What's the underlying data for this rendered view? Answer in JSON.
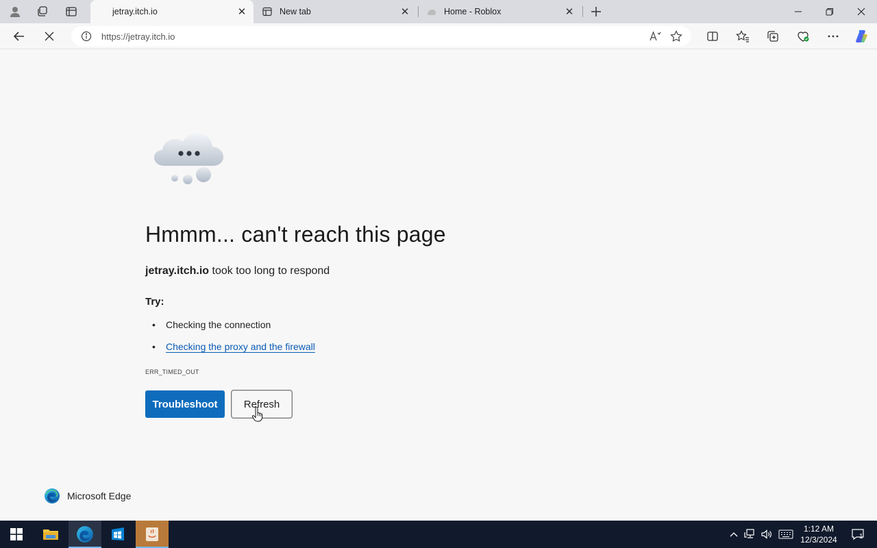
{
  "tabs": [
    {
      "title": "jetray.itch.io",
      "active": true
    },
    {
      "title": "New tab",
      "active": false
    },
    {
      "title": "Home - Roblox",
      "active": false
    }
  ],
  "toolbar": {
    "url": "https://jetray.itch.io"
  },
  "error_page": {
    "heading": "Hmmm... can't reach this page",
    "site": "jetray.itch.io",
    "message": " took too long to respond",
    "try_label": "Try:",
    "suggestions": [
      "Checking the connection",
      "Checking the proxy and the firewall"
    ],
    "error_code": "ERR_TIMED_OUT",
    "troubleshoot_label": "Troubleshoot",
    "refresh_label": "Refresh",
    "brand": "Microsoft Edge"
  },
  "taskbar": {
    "time": "1:12 AM",
    "date": "12/3/2024",
    "notification_count": "1"
  },
  "colors": {
    "accent": "#0f6cbd",
    "link": "#0a5bb5",
    "taskbar": "#101a2c"
  }
}
